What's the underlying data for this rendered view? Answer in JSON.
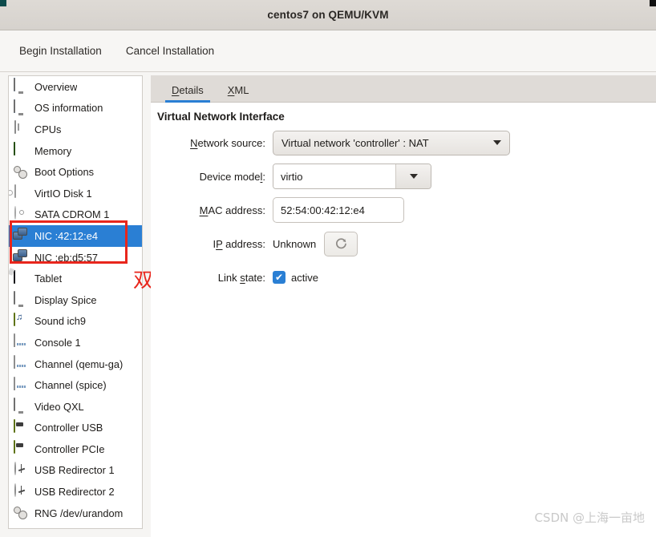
{
  "window": {
    "title": "centos7 on QEMU/KVM"
  },
  "toolbar": {
    "begin_label": "Begin Installation",
    "cancel_label": "Cancel Installation"
  },
  "sidebar": {
    "items": [
      {
        "label": "Overview",
        "icon": "monitor-icon",
        "selected": false
      },
      {
        "label": "OS information",
        "icon": "monitor-icon",
        "selected": false
      },
      {
        "label": "CPUs",
        "icon": "cpu-icon",
        "selected": false
      },
      {
        "label": "Memory",
        "icon": "memory-icon",
        "selected": false
      },
      {
        "label": "Boot Options",
        "icon": "gears-icon",
        "selected": false
      },
      {
        "label": "VirtIO Disk 1",
        "icon": "disk-icon",
        "selected": false
      },
      {
        "label": "SATA CDROM 1",
        "icon": "cdrom-icon",
        "selected": false
      },
      {
        "label": "NIC :42:12:e4",
        "icon": "nic-icon",
        "selected": true
      },
      {
        "label": "NIC :eb:d5:57",
        "icon": "nic-icon",
        "selected": false
      },
      {
        "label": "Tablet",
        "icon": "tablet-icon",
        "selected": false
      },
      {
        "label": "Display Spice",
        "icon": "display-icon",
        "selected": false
      },
      {
        "label": "Sound ich9",
        "icon": "sound-icon",
        "selected": false
      },
      {
        "label": "Console 1",
        "icon": "channel-icon",
        "selected": false
      },
      {
        "label": "Channel (qemu-ga)",
        "icon": "channel-icon",
        "selected": false
      },
      {
        "label": "Channel (spice)",
        "icon": "channel-icon",
        "selected": false
      },
      {
        "label": "Video QXL",
        "icon": "display-icon",
        "selected": false
      },
      {
        "label": "Controller USB",
        "icon": "controller-icon",
        "selected": false
      },
      {
        "label": "Controller PCIe",
        "icon": "controller-icon",
        "selected": false
      },
      {
        "label": "USB Redirector 1",
        "icon": "usb-icon",
        "selected": false
      },
      {
        "label": "USB Redirector 2",
        "icon": "usb-icon",
        "selected": false
      },
      {
        "label": "RNG /dev/urandom",
        "icon": "gears-icon",
        "selected": false
      }
    ]
  },
  "annotations": {
    "red_note": "双网卡",
    "red_color": "#e8261c",
    "watermark": "CSDN @上海一亩地"
  },
  "content": {
    "tabs": [
      {
        "label": "Details",
        "mnemonic": "D",
        "active": true
      },
      {
        "label": "XML",
        "mnemonic": "X",
        "active": false
      }
    ],
    "section_title": "Virtual Network Interface",
    "fields": {
      "network_source": {
        "label": "Network source:",
        "mnemonic": "N",
        "value": "Virtual network 'controller' : NAT"
      },
      "device_model": {
        "label": "Device model:",
        "mnemonic": "l",
        "value": "virtio"
      },
      "mac_address": {
        "label": "MAC address:",
        "mnemonic": "M",
        "value": "52:54:00:42:12:e4"
      },
      "ip_address": {
        "label": "IP address:",
        "mnemonic": "P",
        "value": "Unknown",
        "refresh_icon": "refresh-icon"
      },
      "link_state": {
        "label": "Link state:",
        "mnemonic": "s",
        "checked": true,
        "checkbox_label": "active",
        "check_glyph": "✔"
      }
    }
  },
  "colors": {
    "selection": "#2a7fd4",
    "accent": "#2a7fd4",
    "annotation": "#e8261c"
  }
}
